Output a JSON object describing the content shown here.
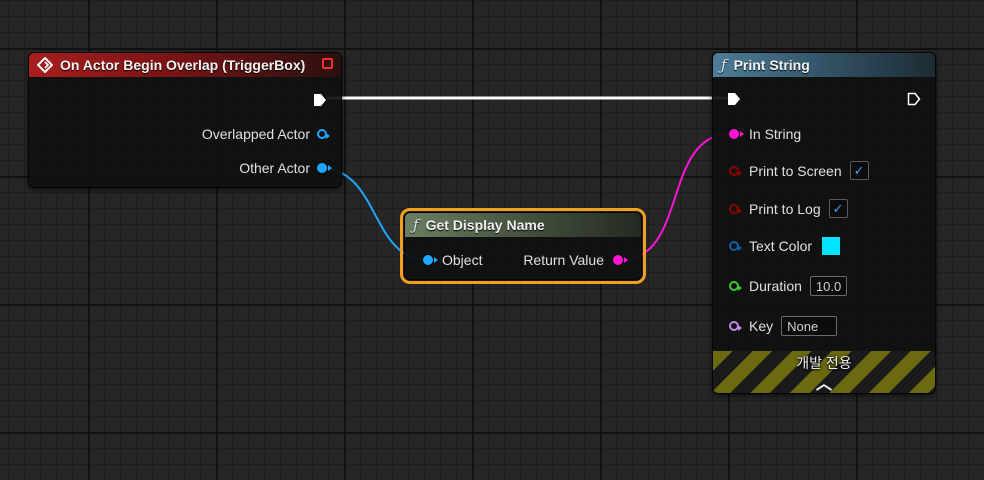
{
  "event_node": {
    "title": "On Actor Begin Overlap (TriggerBox)",
    "header_color": "#a81e1e",
    "icon": "event-diamond-icon",
    "pins": {
      "overlapped_actor": "Overlapped Actor",
      "other_actor": "Other Actor"
    }
  },
  "get_display_name_node": {
    "title": "Get Display Name",
    "icon": "function-icon",
    "selected_outline": "#f0a020",
    "pins": {
      "object": "Object",
      "return_value": "Return Value"
    }
  },
  "print_string_node": {
    "title": "Print String",
    "icon": "function-icon",
    "pins": {
      "in_string": "In String",
      "print_to_screen": "Print to Screen",
      "print_to_log": "Print to Log",
      "text_color": "Text Color",
      "duration": "Duration",
      "key": "Key"
    },
    "values": {
      "print_to_screen": true,
      "print_to_log": true,
      "text_color": "#00e5ff",
      "duration": "10.0",
      "key": "None"
    },
    "dev_only_label": "개발 전용",
    "expand_icon": "chevron-up-icon"
  },
  "pin_colors": {
    "exec": "#ffffff",
    "object": "#1ea7ff",
    "string": "#ff14d7",
    "bool": "#8e0000",
    "struct": "#0a5fa8",
    "float": "#44c634",
    "name": "#c08ae8"
  }
}
